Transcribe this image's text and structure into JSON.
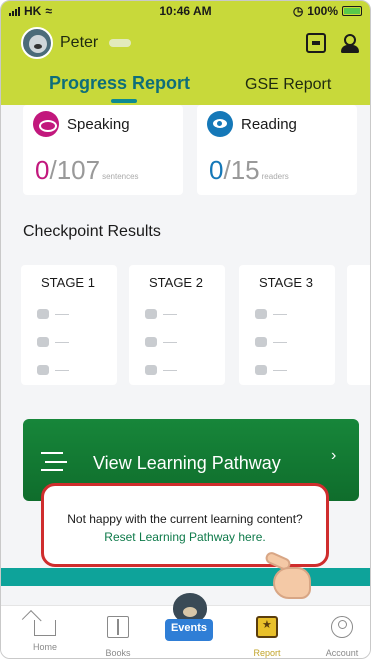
{
  "status_bar": {
    "carrier": "HK",
    "time": "10:46 AM",
    "battery": "100%"
  },
  "header": {
    "user_name": "Peter",
    "icons": [
      "scan-icon",
      "customer-service-icon"
    ]
  },
  "tabs": [
    {
      "label": "Progress Report",
      "active": true
    },
    {
      "label": "GSE Report",
      "active": false
    }
  ],
  "stats": {
    "speaking": {
      "label": "Speaking",
      "value": "0",
      "total": "/107",
      "unit": "sentences",
      "color": "#c2187d"
    },
    "reading": {
      "label": "Reading",
      "value": "0",
      "total": "/15",
      "unit": "readers",
      "color": "#1578b8"
    }
  },
  "checkpoint": {
    "title": "Checkpoint Results",
    "stages": [
      {
        "label": "STAGE 1"
      },
      {
        "label": "STAGE 2"
      },
      {
        "label": "STAGE 3"
      }
    ]
  },
  "pathway": {
    "label": "View Learning Pathway",
    "chevron": "›",
    "reset_prompt": "Not happy with the current learning content?",
    "reset_link": "Reset Learning Pathway here."
  },
  "bottom_nav": [
    {
      "label": "Home",
      "icon": "home-icon"
    },
    {
      "label": "Books",
      "icon": "book-icon"
    },
    {
      "label": "Events",
      "icon": "events-bear-icon"
    },
    {
      "label": "Report",
      "icon": "report-icon",
      "active": true
    },
    {
      "label": "Account",
      "icon": "account-icon"
    }
  ],
  "colors": {
    "header_bg": "#c8d93a",
    "pathway_bg": "#17863a",
    "highlight_border": "#cf2d2d",
    "teal_band": "#0ea39a"
  }
}
